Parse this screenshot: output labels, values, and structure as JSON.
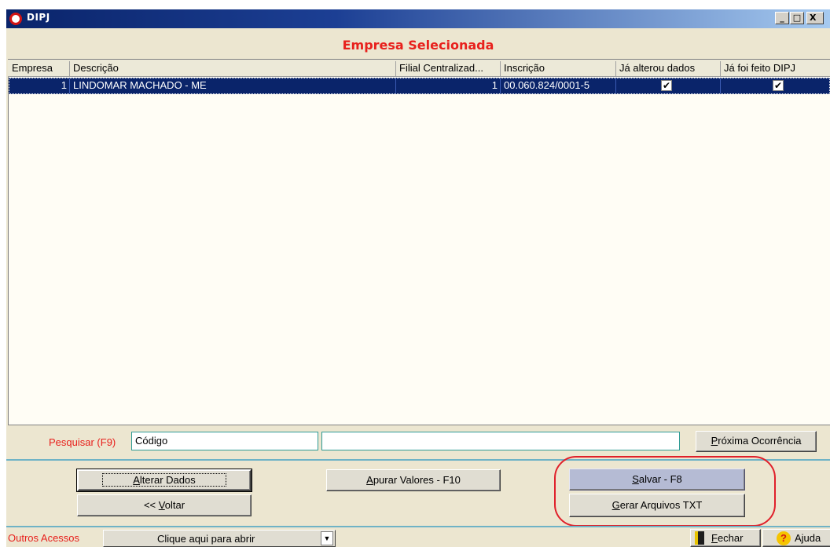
{
  "window": {
    "title": "DIPJ",
    "minimize": "_",
    "maximize": "□",
    "close": "X"
  },
  "grid": {
    "caption": "Empresa Selecionada",
    "columns": [
      "Empresa",
      "Descrição",
      "Filial Centralizad...",
      "Inscrição",
      "Já alterou dados",
      "Já foi feito DIPJ"
    ],
    "rows": [
      {
        "empresa": "1",
        "descricao": "LINDOMAR MACHADO - ME",
        "filial": "1",
        "inscricao": "00.060.824/0001-5",
        "ja_alterou_dados": "✔",
        "ja_feito_dipj": "✔"
      }
    ]
  },
  "search": {
    "label": "Pesquisar (F9)",
    "field": "Código",
    "value": "",
    "next_button": {
      "pre": "",
      "key": "P",
      "post": "róxima Ocorrência"
    }
  },
  "actions": {
    "alterar": {
      "pre": "",
      "key": "A",
      "post": "lterar Dados"
    },
    "voltar": {
      "pre": "<< ",
      "key": "V",
      "post": "oltar"
    },
    "apurar": {
      "pre": "",
      "key": "A",
      "post": "purar Valores  - F10"
    },
    "salvar": {
      "pre": "",
      "key": "S",
      "post": "alvar - F8"
    },
    "gerar": {
      "pre": "",
      "key": "G",
      "post": "erar Arquivos TXT"
    }
  },
  "bottom": {
    "outros_label": "Outros Acessos",
    "outros_select": "Clique aqui para abrir",
    "outros_arrow": "▼",
    "fechar": {
      "pre": "",
      "key": "F",
      "post": "echar"
    },
    "ajuda": {
      "label": "Ajuda",
      "icon_glyph": "?"
    }
  },
  "colors": {
    "accent_red": "#e8201c",
    "selection_blue": "#0a246a",
    "highlight_ring": "#e0202a"
  }
}
